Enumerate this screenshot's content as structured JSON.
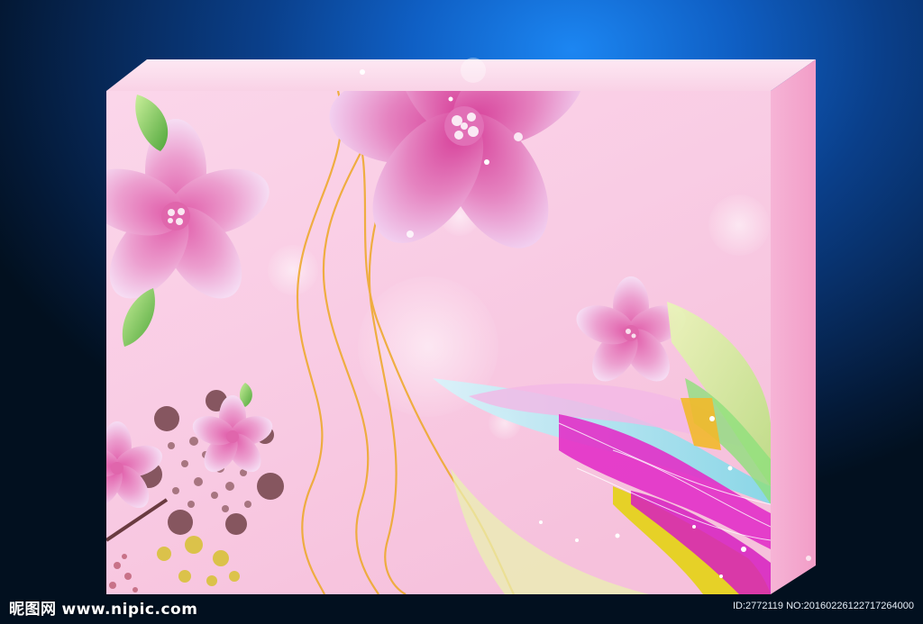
{
  "watermark": {
    "brand": "昵图网",
    "site": "www.nipic.com"
  },
  "image_id_text": "ID:2772119 NO:20160226122717264000",
  "scene": {
    "description_colors": {
      "background_top": "#1c86f2",
      "background_edge": "#02101f",
      "box_front_top": "#fbd6ea",
      "box_front_mid": "#f7c3df",
      "box_top_face": "#fde4f1",
      "box_side_face": "#f4a9cf",
      "flower_main": "#d9469e",
      "flower_light": "#e8b8e8",
      "vine_gold": "#eeaa30",
      "leaf_green": "#8ccc55"
    },
    "icons": [
      "flower-icon",
      "leaf-icon",
      "ribbon-icon",
      "bokeh-circle-icon"
    ]
  }
}
